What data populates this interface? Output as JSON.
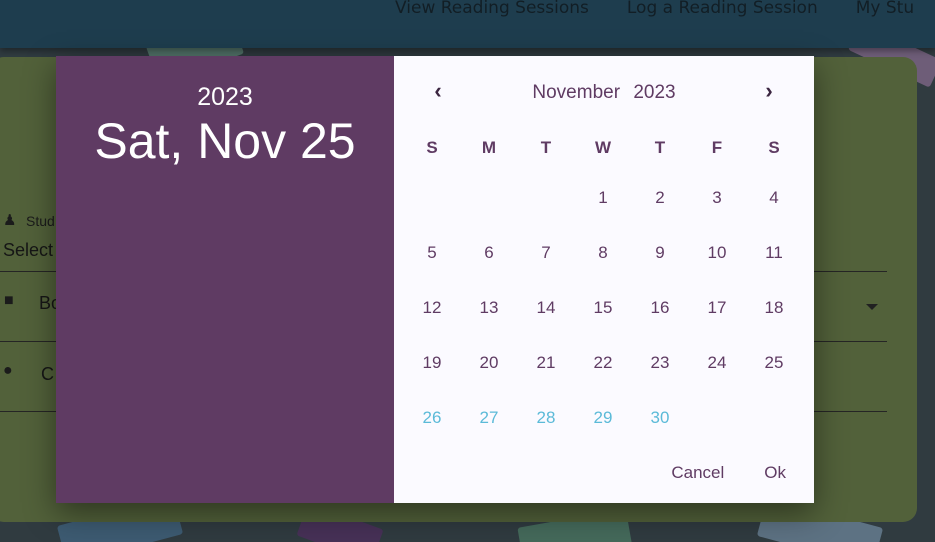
{
  "nav": {
    "items": [
      "View Reading Sessions",
      "Log a Reading Session",
      "My Stu"
    ]
  },
  "form": {
    "student_label": "Stud",
    "student_value": "Select",
    "book_label": "Bo",
    "comment_label": "C"
  },
  "date_picker": {
    "year": "2023",
    "selected_date": "Sat, Nov 25",
    "month_label": "November 2023",
    "weekdays": [
      "S",
      "M",
      "T",
      "W",
      "T",
      "F",
      "S"
    ],
    "leading_blanks": 3,
    "days": [
      "1",
      "2",
      "3",
      "4",
      "5",
      "6",
      "7",
      "8",
      "9",
      "10",
      "11",
      "12",
      "13",
      "14",
      "15",
      "16",
      "17",
      "18",
      "19",
      "20",
      "21",
      "22",
      "23",
      "24",
      "25",
      "26",
      "27",
      "28",
      "29",
      "30"
    ],
    "highlighted_days_from": 26,
    "cancel_label": "Cancel",
    "ok_label": "Ok"
  },
  "colors": {
    "header_bg": "#5f3b63",
    "accent_text": "#5f3b63",
    "future_days": "#5bbad8",
    "appbar": "#2f5f78",
    "card": "#7e9659"
  }
}
